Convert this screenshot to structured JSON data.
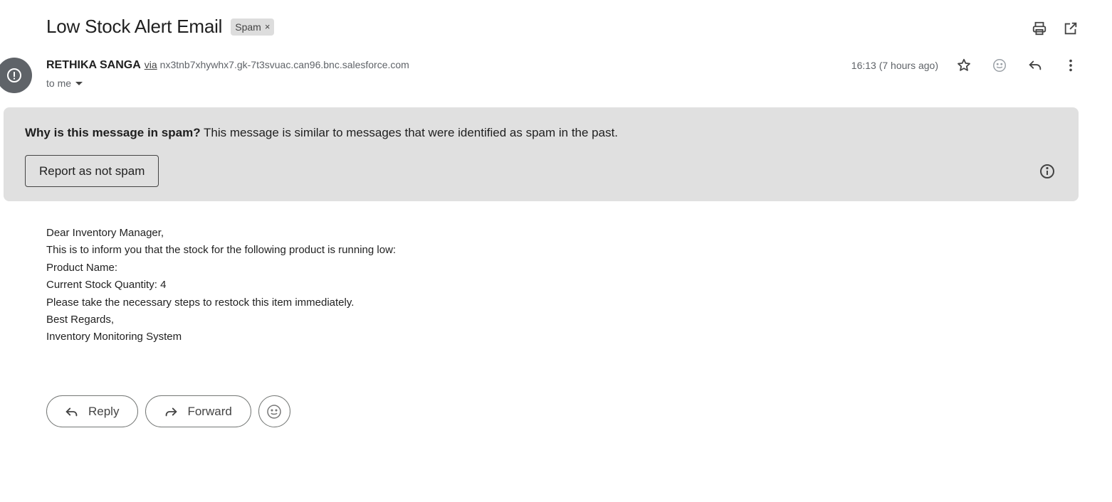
{
  "email": {
    "subject": "Low Stock Alert Email",
    "label_chip": "Spam",
    "label_remove": "×",
    "sender": {
      "name": "RETHIKA SANGA",
      "via": "via",
      "domain": "nx3tnb7xhywhx7.gk-7t3svuac.can96.bnc.salesforce.com"
    },
    "recipient": "to me",
    "timestamp": "16:13 (7 hours ago)"
  },
  "spam_banner": {
    "reason_bold": "Why is this message in spam?",
    "reason_text": " This message is similar to messages that were identified as spam in the past.",
    "button_label": "Report as not spam"
  },
  "body_lines": {
    "l1": "Dear Inventory Manager,",
    "l2": "This is to inform you that the stock for the following product is running low:",
    "l3": "Product Name: ",
    "l4": "Current Stock Quantity: 4",
    "l5": "Please take the necessary steps to restock this item immediately.",
    "l6": "Best Regards,",
    "l7": "Inventory Monitoring System"
  },
  "actions": {
    "reply_label": "Reply",
    "forward_label": "Forward"
  },
  "icons": {
    "top": [
      "print-icon",
      "open-in-new-window-icon"
    ],
    "meta": [
      "star-icon",
      "emoji-reaction-icon",
      "reply-icon",
      "more-vert-icon"
    ],
    "avatar": "spam-warning-icon",
    "banner": "info-icon"
  },
  "colors": {
    "banner_bg": "#e0e0e0",
    "avatar_bg": "#5f6368",
    "chip_bg": "#dddddd"
  }
}
